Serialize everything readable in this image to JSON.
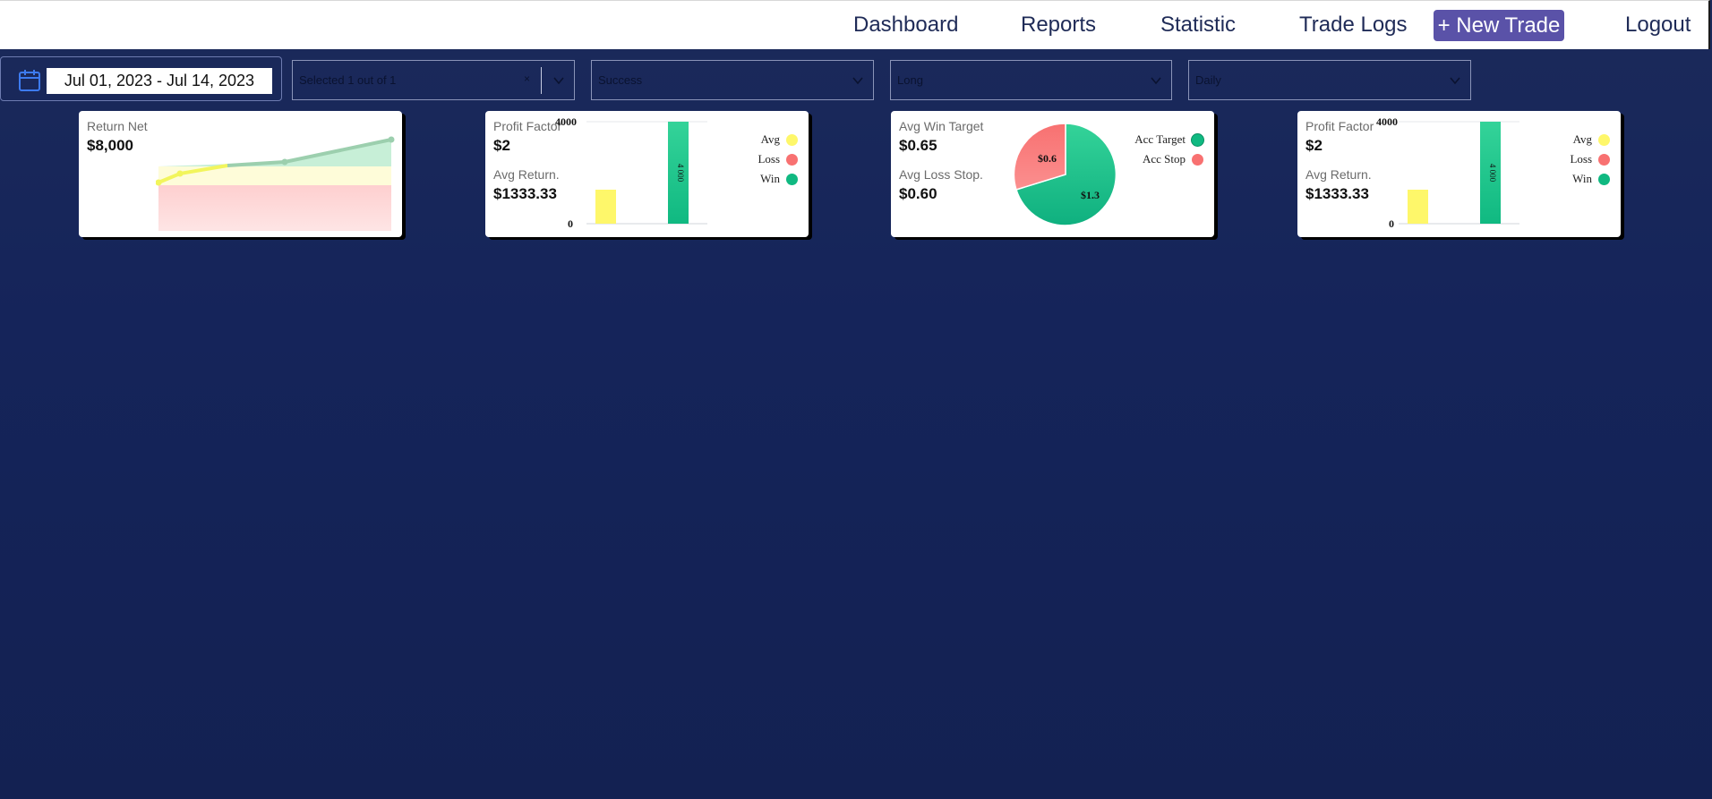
{
  "nav": {
    "items": [
      "Dashboard",
      "Reports",
      "Statistic",
      "Trade Logs"
    ],
    "new_trade": "+ New Trade",
    "logout": "Logout"
  },
  "filters": {
    "date_range": "Jul 01, 2023 - Jul 14, 2023",
    "account_select": "Selected 1 out of 1",
    "account_clear": "×",
    "status_select": "Success",
    "direction_select": "Long",
    "period_select": "Daily"
  },
  "cards": {
    "return_net": {
      "label": "Return Net",
      "value": "$8,000"
    },
    "profit_1": {
      "label1": "Profit Factor",
      "value1": "$2",
      "label2": "Avg Return.",
      "value2": "$1333.33",
      "axis_top": "4000",
      "axis_bottom": "0",
      "bar_label": "4 000",
      "legend": [
        "Avg",
        "Loss",
        "Win"
      ]
    },
    "win_target": {
      "label1": "Avg Win Target",
      "value1": "$0.65",
      "label2": "Avg Loss Stop.",
      "value2": "$0.60",
      "slice_loss": "$0.6",
      "slice_win": "$1.3",
      "legend": [
        "Acc Target",
        "Acc Stop"
      ]
    },
    "profit_2": {
      "label1": "Profit Factor",
      "value1": "$2",
      "label2": "Avg Return.",
      "value2": "$1333.33",
      "axis_top": "4000",
      "axis_bottom": "0",
      "bar_label": "4 000",
      "legend": [
        "Avg",
        "Loss",
        "Win"
      ]
    }
  },
  "colors": {
    "accent": "#5a52a8",
    "win": "#10b981",
    "loss": "#f87171",
    "avg": "#fef08a",
    "nav_text": "#1f2b57"
  },
  "chart_data": [
    {
      "type": "area",
      "title": "Return Net",
      "series": [
        {
          "values": [
            0,
            1000,
            2000,
            4000,
            8000
          ]
        }
      ]
    },
    {
      "type": "bar",
      "title": "Profit Factor",
      "ylim": [
        0,
        4000
      ],
      "categories": [
        "Avg",
        "Loss",
        "Win"
      ],
      "values": [
        1333.33,
        0,
        4000
      ]
    },
    {
      "type": "pie",
      "title": "Avg Win Target",
      "categories": [
        "Acc Stop",
        "Acc Target"
      ],
      "values": [
        0.6,
        1.3
      ]
    },
    {
      "type": "bar",
      "title": "Profit Factor",
      "ylim": [
        0,
        4000
      ],
      "categories": [
        "Avg",
        "Loss",
        "Win"
      ],
      "values": [
        1333.33,
        0,
        4000
      ]
    }
  ]
}
